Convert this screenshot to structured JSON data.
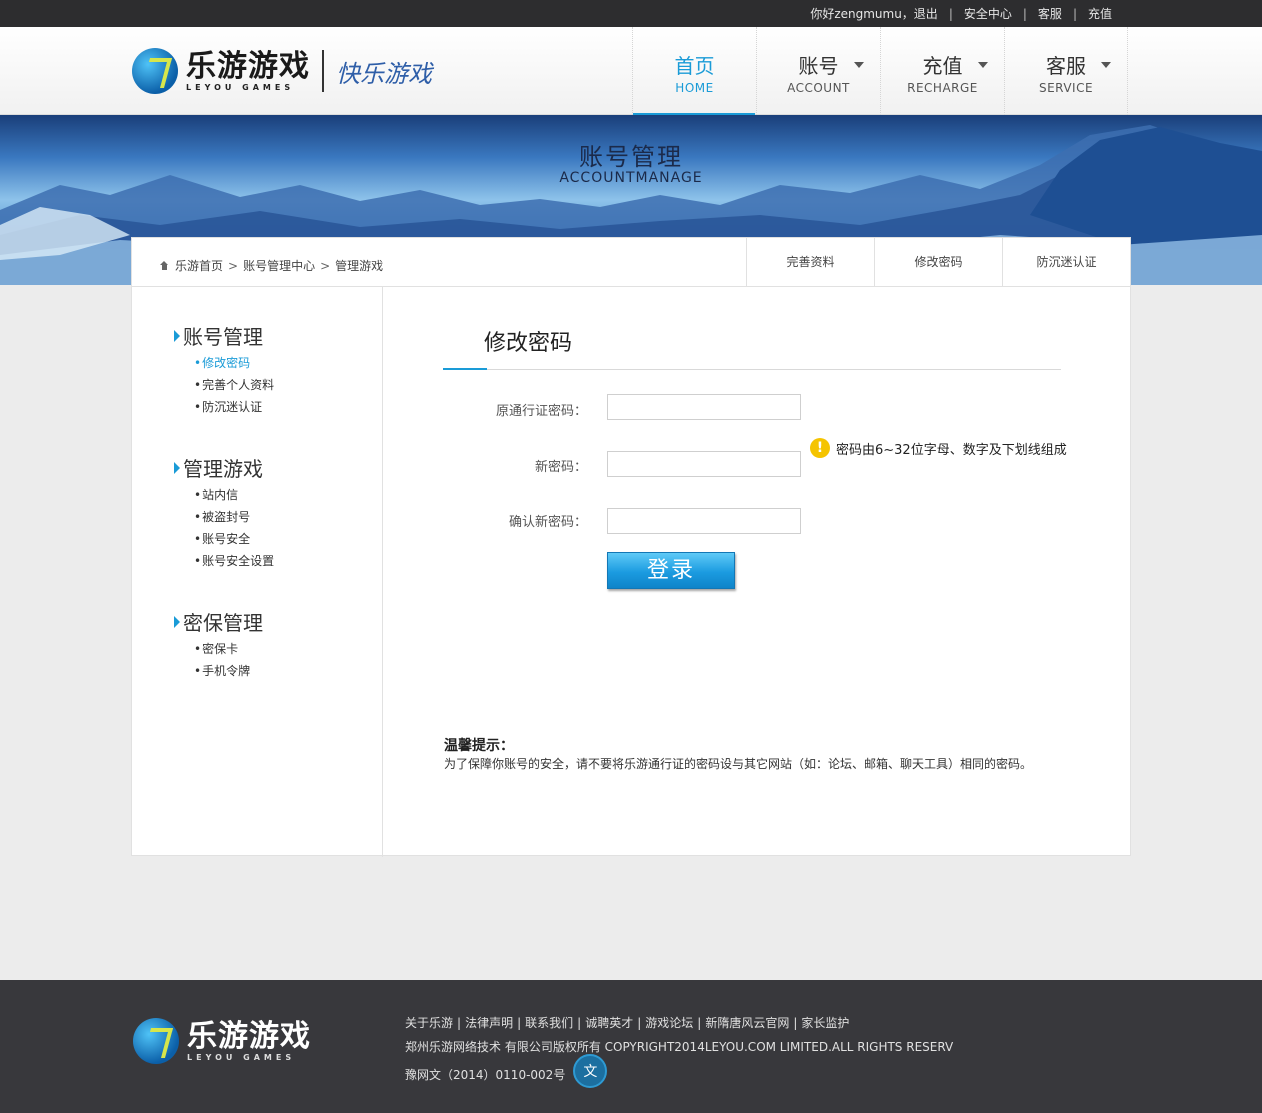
{
  "topbar": {
    "greeting": "你好zengmumu，退出",
    "links": [
      "安全中心",
      "客服",
      "充值"
    ]
  },
  "brand": {
    "name_cn": "乐游游戏",
    "name_en": "LEYOU GAMES",
    "slogan": "快乐游戏"
  },
  "nav": [
    {
      "cn": "首页",
      "en": "HOME",
      "active": true
    },
    {
      "cn": "账号",
      "en": "ACCOUNT",
      "active": false
    },
    {
      "cn": "充值",
      "en": "RECHARGE",
      "active": false
    },
    {
      "cn": "客服",
      "en": "SERVICE",
      "active": false
    }
  ],
  "banner": {
    "title_cn": "账号管理",
    "title_en": "ACCOUNTMANAGE"
  },
  "breadcrumb": [
    "乐游首页",
    "账号管理中心",
    "管理游戏"
  ],
  "tabs": [
    "完善资料",
    "修改密码",
    "防沉迷认证"
  ],
  "sidebar": [
    {
      "title": "账号管理",
      "items": [
        "修改密码",
        "完善个人资料",
        "防沉迷认证"
      ]
    },
    {
      "title": "管理游戏",
      "items": [
        "站内信",
        "被盗封号",
        "账号安全",
        "账号安全设置"
      ]
    },
    {
      "title": "密保管理",
      "items": [
        "密保卡",
        "手机令牌"
      ]
    }
  ],
  "form": {
    "title": "修改密码",
    "old_password_label": "原通行证密码：",
    "new_password_label": "新密码：",
    "confirm_password_label": "确认新密码：",
    "old_password_value": "",
    "new_password_value": "",
    "confirm_password_value": "",
    "hint": "密码由6~32位字母、数字及下划线组成",
    "submit_label": "登录"
  },
  "tips": {
    "title": "温馨提示：",
    "text": "为了保障你账号的安全，请不要将乐游通行证的密码设与其它网站（如：论坛、邮箱、聊天工具）相同的密码。"
  },
  "footer": {
    "links": [
      "关于乐游",
      "法律声明",
      "联系我们",
      "诚聘英才",
      "游戏论坛",
      "新隋唐风云官网",
      "家长监护"
    ],
    "copyright": "郑州乐游网络技术 有限公司版权所有 COPYRIGHT2014LEYOU.COM LIMITED.ALL RIGHTS RESERV",
    "icp": "豫网文（2014）0110-002号",
    "badge_glyph": "文"
  },
  "colors": {
    "accent": "#1a9bd7",
    "topbar_bg": "#2d2d2f",
    "footer_bg": "#38383c",
    "warn": "#f5c400"
  }
}
